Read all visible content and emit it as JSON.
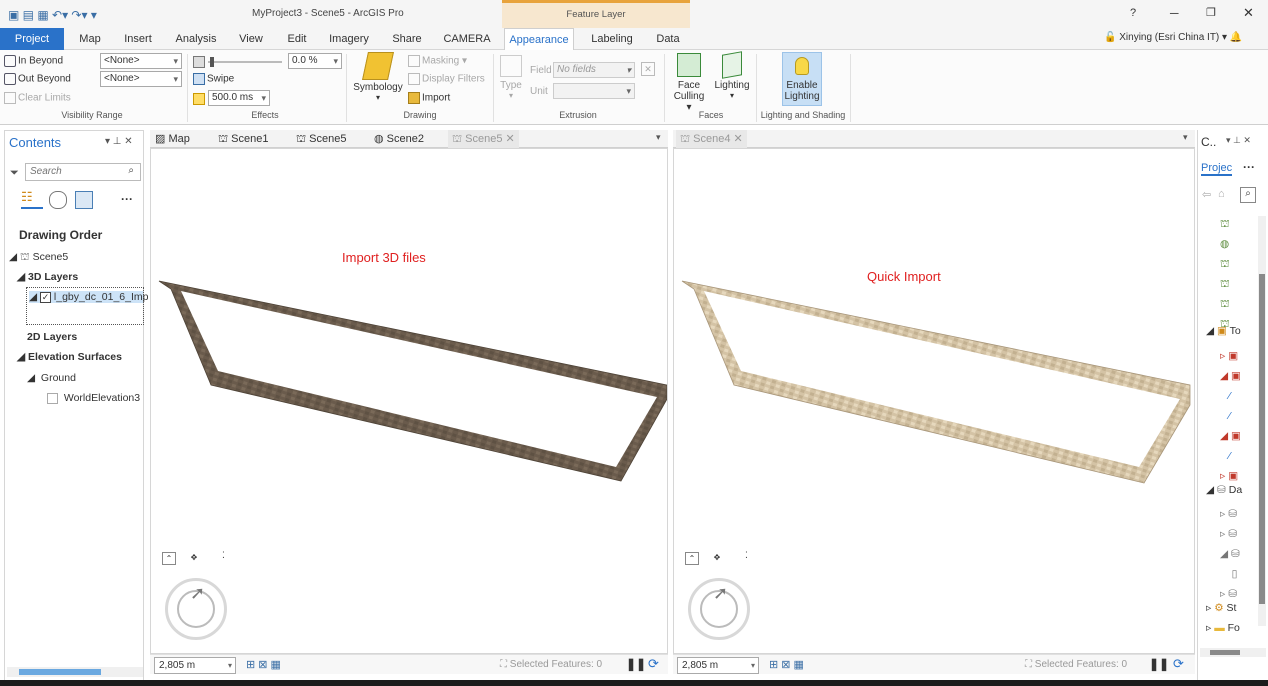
{
  "app": {
    "title": "MyProject3 - Scene5 - ArcGIS Pro",
    "context_tab": "Feature Layer",
    "user": "Xinying (Esri China IT)",
    "help": "?"
  },
  "tabs": [
    "Project",
    "Map",
    "Insert",
    "Analysis",
    "View",
    "Edit",
    "Imagery",
    "Share",
    "CAMERA",
    "Appearance",
    "Labeling",
    "Data"
  ],
  "ribbon": {
    "visibility": {
      "in_beyond": "In Beyond",
      "out_beyond": "Out Beyond",
      "clear_limits": "Clear Limits",
      "none1": "<None>",
      "none2": "<None>",
      "label": "Visibility Range"
    },
    "effects": {
      "percent": "0.0 %",
      "swipe": "Swipe",
      "ms": "500.0  ms",
      "label": "Effects"
    },
    "drawing": {
      "symbology": "Symbology",
      "masking": "Masking",
      "display_filters": "Display Filters",
      "import": "Import",
      "label": "Drawing"
    },
    "extrusion": {
      "type": "Type",
      "field": "Field",
      "field_value": "No fields",
      "unit": "Unit",
      "label": "Extrusion"
    },
    "faces": {
      "face_culling_1": "Face",
      "face_culling_2": "Culling",
      "lighting": "Lighting",
      "label": "Faces"
    },
    "lighting": {
      "enable_1": "Enable",
      "enable_2": "Lighting",
      "label": "Lighting and Shading"
    }
  },
  "contents": {
    "title": "Contents",
    "search_placeholder": "Search",
    "drawing_order": "Drawing Order",
    "scene": "Scene5",
    "layers_3d": "3D Layers",
    "layer_name": "l_gby_dc_01_6_Imp",
    "layers_2d": "2D Layers",
    "elevation": "Elevation Surfaces",
    "ground": "Ground",
    "world_elevation": "WorldElevation3"
  },
  "view_tabs": [
    "Map",
    "Scene1",
    "Scene5",
    "Scene2",
    "Scene5",
    "Scene4"
  ],
  "left_view": {
    "annotation": "Import 3D files",
    "scale": "2,805 m",
    "selected": "Selected Features: 0"
  },
  "right_view": {
    "annotation": "Quick Import",
    "scale": "2,805 m",
    "selected": "Selected Features: 0"
  },
  "catalog": {
    "title": "C..",
    "project": "Projec",
    "items": [
      "To",
      "Da",
      "St",
      "Fo"
    ]
  },
  "colors": {
    "accent": "#2a72c9",
    "annotation": "#e02020",
    "dark_frame": "#6e5f50",
    "light_frame": "#d8c7a8"
  }
}
